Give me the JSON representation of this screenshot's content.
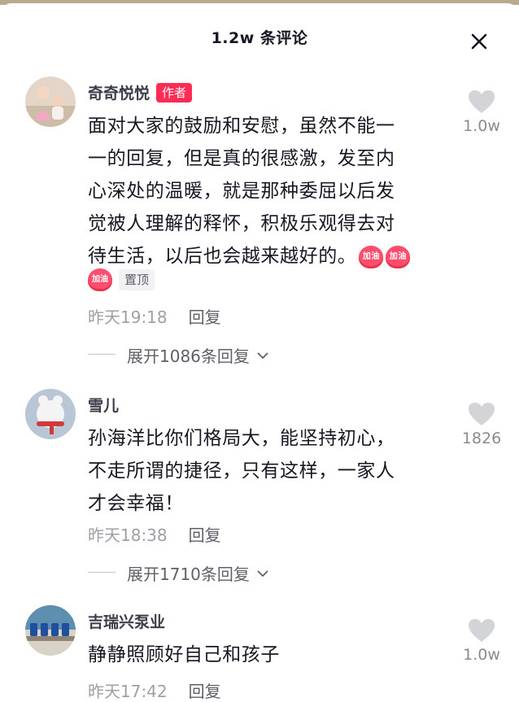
{
  "header": {
    "title": "1.2w 条评论"
  },
  "comments": [
    {
      "name": "奇奇悦悦",
      "author_tag": "作者",
      "text_lines": [
        "面对大家的鼓励和安慰，虽然不能一",
        "一的回复，但是真的很感激，发至内",
        "心深处的温暖，就是那种委屈以后发",
        "觉被人理解的释怀，积极乐观得去对",
        "待生活，以后也会越来越好的。"
      ],
      "emoji_label": "加油",
      "pinned": "置顶",
      "time": "昨天19:18",
      "reply": "回复",
      "expand": "展开1086条回复",
      "likes": "1.0w",
      "avatar_color": "#e3d6c8"
    },
    {
      "name": "雪儿",
      "text_lines": [
        "孙海洋比你们格局大，能坚持初心，",
        "不走所谓的捷径，只有这样，一家人",
        "才会幸福！"
      ],
      "time": "昨天18:38",
      "reply": "回复",
      "expand": "展开1710条回复",
      "likes": "1826",
      "avatar_color": "#b8c6d6"
    },
    {
      "name": "吉瑞兴泵业",
      "text_lines": [
        "静静照顾好自己和孩子"
      ],
      "time": "昨天17:42",
      "reply": "回复",
      "likes": "1.0w",
      "avatar_color": "#5f8fb0"
    }
  ],
  "colors": {
    "accent": "#fe2c55",
    "heart": "#d3d4d8",
    "secondary_text": "#9ea0a8"
  },
  "icons": {
    "close": "close-icon",
    "like": "heart-icon",
    "expand": "chevron-down-icon"
  }
}
